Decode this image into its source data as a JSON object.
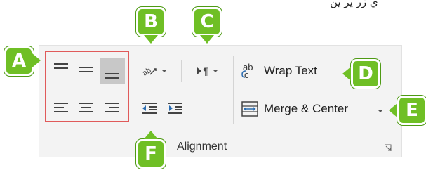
{
  "header_text": "ي زر ير ين",
  "alignment_group": {
    "label": "Alignment",
    "wrap_text_label": "Wrap Text",
    "wrap_text_icon_text": "ab",
    "wrap_text_icon_sub": "c",
    "merge_center_label": "Merge & Center",
    "indent_icon_text": "¶"
  },
  "callouts": {
    "a": "A",
    "b": "B",
    "c": "C",
    "d": "D",
    "e": "E",
    "f": "F"
  },
  "colors": {
    "callout_green": "#6fbf25",
    "highlight_box": "#e05a5a",
    "indent_arrow": "#2b6cb0",
    "selected_button": "#c8c8c8"
  }
}
